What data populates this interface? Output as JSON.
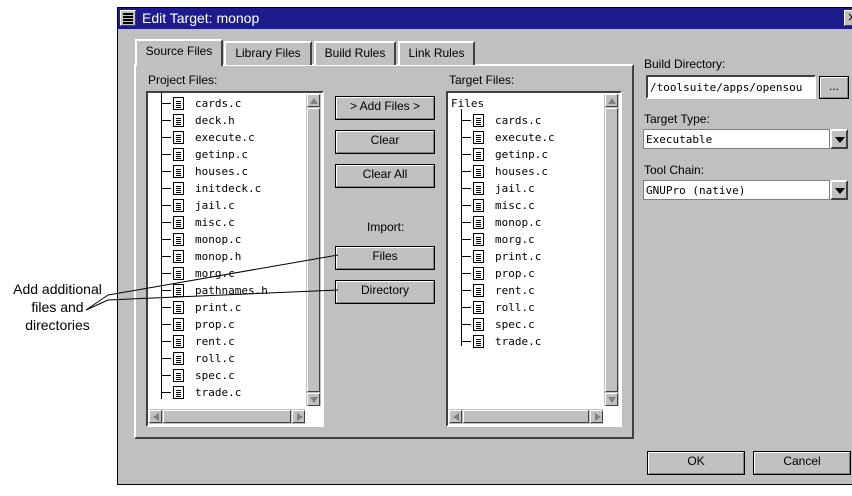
{
  "window": {
    "title": "Edit Target: monop",
    "close_label": "×"
  },
  "tabs": [
    {
      "label": "Source Files",
      "active": true
    },
    {
      "label": "Library Files",
      "active": false
    },
    {
      "label": "Build Rules",
      "active": false
    },
    {
      "label": "Link Rules",
      "active": false
    }
  ],
  "project_files": {
    "label": "Project Files:",
    "items": [
      "cards.c",
      "deck.h",
      "execute.c",
      "getinp.c",
      "houses.c",
      "initdeck.c",
      "jail.c",
      "misc.c",
      "monop.c",
      "monop.h",
      "morg.c",
      "pathnames.h",
      "print.c",
      "prop.c",
      "rent.c",
      "roll.c",
      "spec.c",
      "trade.c"
    ]
  },
  "buttons": {
    "add_files": "> Add Files >",
    "clear": "Clear",
    "clear_all": "Clear All",
    "import_label": "Import:",
    "import_files": "Files",
    "import_directory": "Directory",
    "ok": "OK",
    "cancel": "Cancel"
  },
  "target_files": {
    "label": "Target Files:",
    "root": "Files",
    "items": [
      "cards.c",
      "execute.c",
      "getinp.c",
      "houses.c",
      "jail.c",
      "misc.c",
      "monop.c",
      "morg.c",
      "print.c",
      "prop.c",
      "rent.c",
      "roll.c",
      "spec.c",
      "trade.c"
    ]
  },
  "build_directory": {
    "label": "Build Directory:",
    "value": "/toolsuite/apps/opensou",
    "browse_label": "..."
  },
  "target_type": {
    "label": "Target Type:",
    "value": "Executable"
  },
  "tool_chain": {
    "label": "Tool Chain:",
    "value": "GNUPro (native)"
  },
  "annotation": {
    "line1": "Add additional",
    "line2": "files and",
    "line3": "directories"
  }
}
